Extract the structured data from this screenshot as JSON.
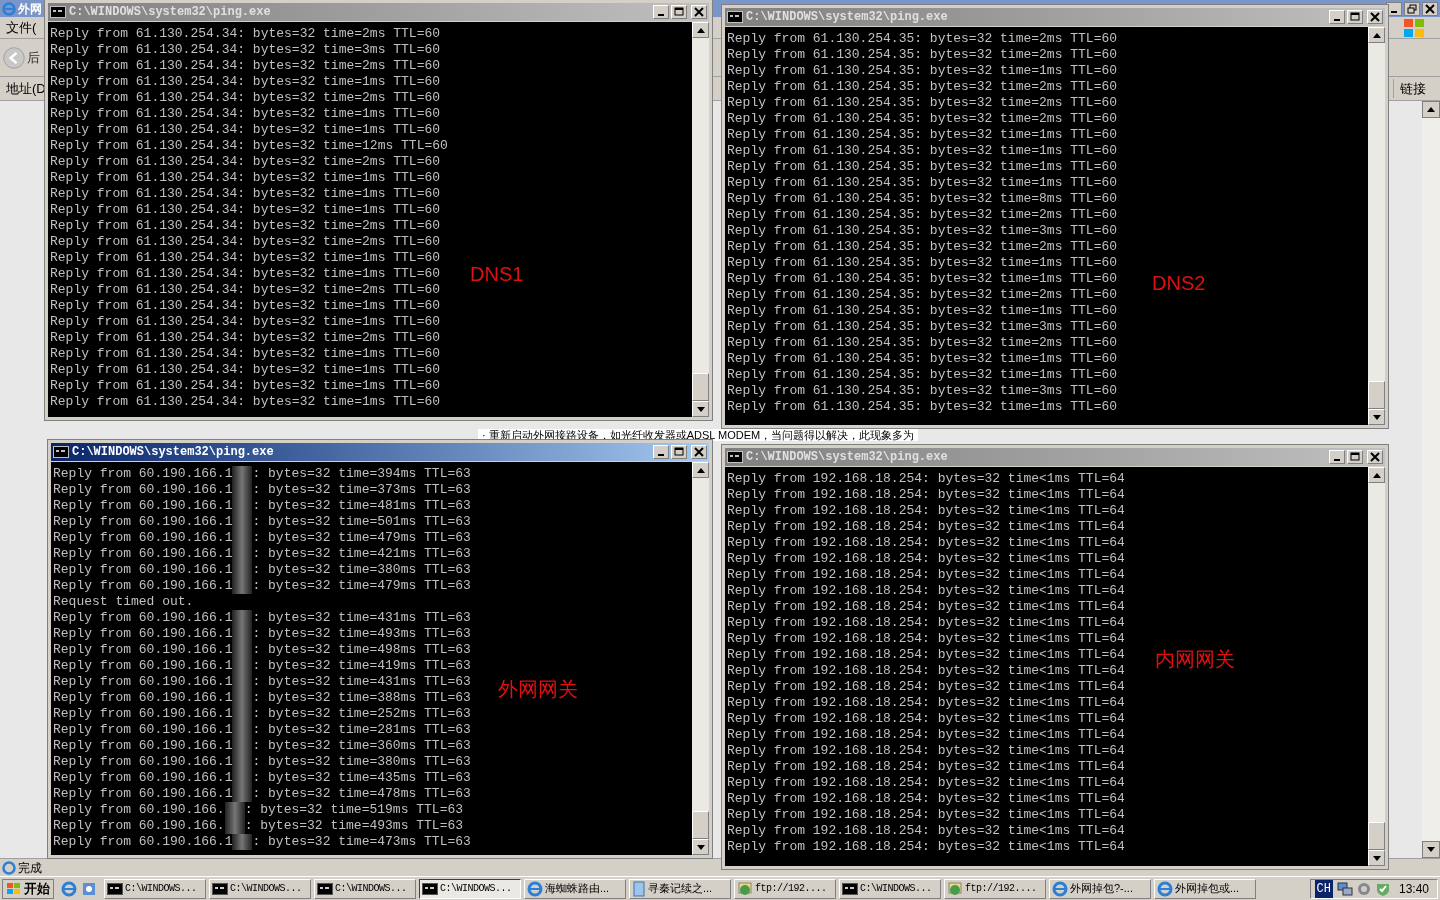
{
  "browser": {
    "title": "外网",
    "menu_item": "文件(",
    "back_label": "后",
    "address_label": "地址(D",
    "links_label": "链接",
    "content_snippet": "· 重新启动外网接路设备，如光纤收发器或ADSL MODEM，当问题得以解决，此现象多为",
    "status": "完成"
  },
  "windows": [
    {
      "title": "C:\\WINDOWS\\system32\\ping.exe",
      "active": false,
      "label": "DNS1",
      "lines": [
        "Reply from 61.130.254.34: bytes=32 time=2ms TTL=60",
        "Reply from 61.130.254.34: bytes=32 time=3ms TTL=60",
        "Reply from 61.130.254.34: bytes=32 time=2ms TTL=60",
        "Reply from 61.130.254.34: bytes=32 time=1ms TTL=60",
        "Reply from 61.130.254.34: bytes=32 time=2ms TTL=60",
        "Reply from 61.130.254.34: bytes=32 time=1ms TTL=60",
        "Reply from 61.130.254.34: bytes=32 time=1ms TTL=60",
        "Reply from 61.130.254.34: bytes=32 time=12ms TTL=60",
        "Reply from 61.130.254.34: bytes=32 time=2ms TTL=60",
        "Reply from 61.130.254.34: bytes=32 time=1ms TTL=60",
        "Reply from 61.130.254.34: bytes=32 time=1ms TTL=60",
        "Reply from 61.130.254.34: bytes=32 time=1ms TTL=60",
        "Reply from 61.130.254.34: bytes=32 time=2ms TTL=60",
        "Reply from 61.130.254.34: bytes=32 time=2ms TTL=60",
        "Reply from 61.130.254.34: bytes=32 time=1ms TTL=60",
        "Reply from 61.130.254.34: bytes=32 time=1ms TTL=60",
        "Reply from 61.130.254.34: bytes=32 time=2ms TTL=60",
        "Reply from 61.130.254.34: bytes=32 time=1ms TTL=60",
        "Reply from 61.130.254.34: bytes=32 time=1ms TTL=60",
        "Reply from 61.130.254.34: bytes=32 time=2ms TTL=60",
        "Reply from 61.130.254.34: bytes=32 time=1ms TTL=60",
        "Reply from 61.130.254.34: bytes=32 time=1ms TTL=60",
        "Reply from 61.130.254.34: bytes=32 time=1ms TTL=60",
        "Reply from 61.130.254.34: bytes=32 time=1ms TTL=60"
      ]
    },
    {
      "title": "C:\\WINDOWS\\system32\\ping.exe",
      "active": false,
      "label": "DNS2",
      "lines": [
        "Reply from 61.130.254.35: bytes=32 time=2ms TTL=60",
        "Reply from 61.130.254.35: bytes=32 time=2ms TTL=60",
        "Reply from 61.130.254.35: bytes=32 time=1ms TTL=60",
        "Reply from 61.130.254.35: bytes=32 time=2ms TTL=60",
        "Reply from 61.130.254.35: bytes=32 time=2ms TTL=60",
        "Reply from 61.130.254.35: bytes=32 time=2ms TTL=60",
        "Reply from 61.130.254.35: bytes=32 time=1ms TTL=60",
        "Reply from 61.130.254.35: bytes=32 time=1ms TTL=60",
        "Reply from 61.130.254.35: bytes=32 time=1ms TTL=60",
        "Reply from 61.130.254.35: bytes=32 time=1ms TTL=60",
        "Reply from 61.130.254.35: bytes=32 time=8ms TTL=60",
        "Reply from 61.130.254.35: bytes=32 time=2ms TTL=60",
        "Reply from 61.130.254.35: bytes=32 time=3ms TTL=60",
        "Reply from 61.130.254.35: bytes=32 time=2ms TTL=60",
        "Reply from 61.130.254.35: bytes=32 time=1ms TTL=60",
        "Reply from 61.130.254.35: bytes=32 time=1ms TTL=60",
        "Reply from 61.130.254.35: bytes=32 time=2ms TTL=60",
        "Reply from 61.130.254.35: bytes=32 time=1ms TTL=60",
        "Reply from 61.130.254.35: bytes=32 time=3ms TTL=60",
        "Reply from 61.130.254.35: bytes=32 time=2ms TTL=60",
        "Reply from 61.130.254.35: bytes=32 time=1ms TTL=60",
        "Reply from 61.130.254.35: bytes=32 time=1ms TTL=60",
        "Reply from 61.130.254.35: bytes=32 time=3ms TTL=60",
        "Reply from 61.130.254.35: bytes=32 time=1ms TTL=60"
      ]
    },
    {
      "title": "C:\\WINDOWS\\system32\\ping.exe",
      "active": true,
      "label": "外网网关",
      "lines": [
        {
          "kind": "redacted",
          "before": "Reply from 60.190.166.1",
          "after": ": bytes=32 time=394ms TTL=63"
        },
        {
          "kind": "redacted",
          "before": "Reply from 60.190.166.1",
          "after": ": bytes=32 time=373ms TTL=63"
        },
        {
          "kind": "redacted",
          "before": "Reply from 60.190.166.1",
          "after": ": bytes=32 time=481ms TTL=63"
        },
        {
          "kind": "redacted",
          "before": "Reply from 60.190.166.1",
          "after": ": bytes=32 time=501ms TTL=63"
        },
        {
          "kind": "redacted",
          "before": "Reply from 60.190.166.1",
          "after": ": bytes=32 time=479ms TTL=63"
        },
        {
          "kind": "redacted",
          "before": "Reply from 60.190.166.1",
          "after": ": bytes=32 time=421ms TTL=63"
        },
        {
          "kind": "redacted",
          "before": "Reply from 60.190.166.1",
          "after": ": bytes=32 time=380ms TTL=63"
        },
        {
          "kind": "redacted",
          "before": "Reply from 60.190.166.1",
          "after": ": bytes=32 time=479ms TTL=63"
        },
        {
          "kind": "plain",
          "text": "Request timed out."
        },
        {
          "kind": "redacted",
          "before": "Reply from 60.190.166.1",
          "after": ": bytes=32 time=431ms TTL=63"
        },
        {
          "kind": "redacted",
          "before": "Reply from 60.190.166.1",
          "after": ": bytes=32 time=493ms TTL=63"
        },
        {
          "kind": "redacted",
          "before": "Reply from 60.190.166.1",
          "after": ": bytes=32 time=498ms TTL=63"
        },
        {
          "kind": "redacted",
          "before": "Reply from 60.190.166.1",
          "after": ": bytes=32 time=419ms TTL=63"
        },
        {
          "kind": "redacted",
          "before": "Reply from 60.190.166.1",
          "after": ": bytes=32 time=431ms TTL=63"
        },
        {
          "kind": "redacted",
          "before": "Reply from 60.190.166.1",
          "after": ": bytes=32 time=388ms TTL=63"
        },
        {
          "kind": "redacted",
          "before": "Reply from 60.190.166.1",
          "after": ": bytes=32 time=252ms TTL=63"
        },
        {
          "kind": "redacted",
          "before": "Reply from 60.190.166.1",
          "after": ": bytes=32 time=281ms TTL=63"
        },
        {
          "kind": "redacted",
          "before": "Reply from 60.190.166.1",
          "after": ": bytes=32 time=360ms TTL=63"
        },
        {
          "kind": "redacted",
          "before": "Reply from 60.190.166.1",
          "after": ": bytes=32 time=380ms TTL=63"
        },
        {
          "kind": "redacted",
          "before": "Reply from 60.190.166.1",
          "after": ": bytes=32 time=435ms TTL=63"
        },
        {
          "kind": "redacted",
          "before": "Reply from 60.190.166.1",
          "after": ": bytes=32 time=478ms TTL=63"
        },
        {
          "kind": "redacted",
          "before": "Reply from 60.190.166.",
          "after": ": bytes=32 time=519ms TTL=63"
        },
        {
          "kind": "redacted",
          "before": "Reply from 60.190.166.",
          "after": ": bytes=32 time=493ms TTL=63"
        },
        {
          "kind": "redacted",
          "before": "Reply from 60.190.166.1",
          "after": ": bytes=32 time=473ms TTL=63"
        }
      ]
    },
    {
      "title": "C:\\WINDOWS\\system32\\ping.exe",
      "active": false,
      "label": "内网网关",
      "lines": [
        "Reply from 192.168.18.254: bytes=32 time<1ms TTL=64",
        "Reply from 192.168.18.254: bytes=32 time<1ms TTL=64",
        "Reply from 192.168.18.254: bytes=32 time<1ms TTL=64",
        "Reply from 192.168.18.254: bytes=32 time<1ms TTL=64",
        "Reply from 192.168.18.254: bytes=32 time<1ms TTL=64",
        "Reply from 192.168.18.254: bytes=32 time<1ms TTL=64",
        "Reply from 192.168.18.254: bytes=32 time<1ms TTL=64",
        "Reply from 192.168.18.254: bytes=32 time<1ms TTL=64",
        "Reply from 192.168.18.254: bytes=32 time<1ms TTL=64",
        "Reply from 192.168.18.254: bytes=32 time<1ms TTL=64",
        "Reply from 192.168.18.254: bytes=32 time<1ms TTL=64",
        "Reply from 192.168.18.254: bytes=32 time<1ms TTL=64",
        "Reply from 192.168.18.254: bytes=32 time<1ms TTL=64",
        "Reply from 192.168.18.254: bytes=32 time<1ms TTL=64",
        "Reply from 192.168.18.254: bytes=32 time<1ms TTL=64",
        "Reply from 192.168.18.254: bytes=32 time<1ms TTL=64",
        "Reply from 192.168.18.254: bytes=32 time<1ms TTL=64",
        "Reply from 192.168.18.254: bytes=32 time<1ms TTL=64",
        "Reply from 192.168.18.254: bytes=32 time<1ms TTL=64",
        "Reply from 192.168.18.254: bytes=32 time<1ms TTL=64",
        "Reply from 192.168.18.254: bytes=32 time<1ms TTL=64",
        "Reply from 192.168.18.254: bytes=32 time<1ms TTL=64",
        "Reply from 192.168.18.254: bytes=32 time<1ms TTL=64",
        "Reply from 192.168.18.254: bytes=32 time<1ms TTL=64"
      ]
    }
  ],
  "taskbar": {
    "start": "开始",
    "tasks": [
      {
        "kind": "console",
        "label": "C:\\WINDOWS...",
        "selected": false
      },
      {
        "kind": "console",
        "label": "C:\\WINDOWS...",
        "selected": false
      },
      {
        "kind": "console",
        "label": "C:\\WINDOWS...",
        "selected": false
      },
      {
        "kind": "console",
        "label": "C:\\WINDOWS...",
        "selected": true
      },
      {
        "kind": "browser",
        "label": "海蜘蛛路由...",
        "selected": false
      },
      {
        "kind": "document",
        "label": "寻秦记续之...",
        "selected": false
      },
      {
        "kind": "ftp",
        "label": "ftp://192....",
        "selected": false
      },
      {
        "kind": "console",
        "label": "C:\\WINDOWS...",
        "selected": false
      },
      {
        "kind": "ftp",
        "label": "ftp://192....",
        "selected": false
      },
      {
        "kind": "browser",
        "label": "外网掉包?-...",
        "selected": false
      },
      {
        "kind": "browser",
        "label": "外网掉包或...",
        "selected": false
      }
    ],
    "language": "CH",
    "clock": "13:40"
  }
}
